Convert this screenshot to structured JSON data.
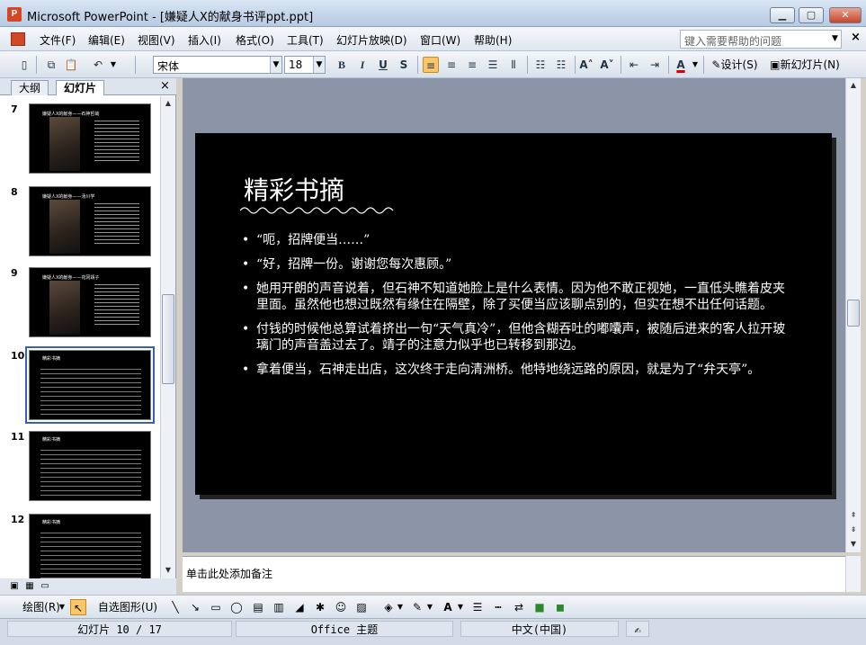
{
  "window": {
    "title": "Microsoft PowerPoint - [嫌疑人X的献身书评ppt.ppt]",
    "app_icon": "P",
    "controls": {
      "minimize": "▁",
      "maximize": "▢",
      "close": "✕"
    }
  },
  "menubar": {
    "items": [
      "文件(F)",
      "编辑(E)",
      "视图(V)",
      "插入(I)",
      "格式(O)",
      "工具(T)",
      "幻灯片放映(D)",
      "窗口(W)",
      "帮助(H)"
    ],
    "help_placeholder": "键入需要帮助的问题",
    "doc_close": "×"
  },
  "toolbar": {
    "font_name": "宋体",
    "font_size": "18",
    "bold": "B",
    "italic": "I",
    "underline": "U",
    "shadow": "S",
    "design_label": "设计(S)",
    "new_slide_label": "新幻灯片(N)"
  },
  "left_pane": {
    "tabs": [
      "大纲",
      "幻灯片"
    ],
    "close": "×",
    "thumbnails": [
      {
        "number": "7",
        "title": "嫌疑人X的献身——石神哲哉",
        "kind": "photo"
      },
      {
        "number": "8",
        "title": "嫌疑人X的献身——汤川学",
        "kind": "photo"
      },
      {
        "number": "9",
        "title": "嫌疑人X的献身——花冈靖子",
        "kind": "photo"
      },
      {
        "number": "10",
        "title": "精彩书摘",
        "kind": "text",
        "selected": true
      },
      {
        "number": "11",
        "title": "精彩书摘",
        "kind": "text"
      },
      {
        "number": "12",
        "title": "精彩书摘",
        "kind": "text"
      }
    ]
  },
  "slide": {
    "title": "精彩书摘",
    "bullets": [
      "“呃，招牌便当……”",
      "“好，招牌一份。谢谢您每次惠顾。”",
      "她用开朗的声音说着，但石神不知道她脸上是什么表情。因为他不敢正视她，一直低头瞧着皮夹里面。虽然他也想过既然有缘住在隔壁，除了买便当应该聊点别的，但实在想不出任何话题。",
      "付钱的时候他总算试着挤出一句“天气真冷”，但他含糊吞吐的嘟囔声，被随后进来的客人拉开玻璃门的声音盖过去了。靖子的注意力似乎也已转移到那边。",
      "拿着便当，石神走出店，这次终于走向清洲桥。他特地绕远路的原因，就是为了“弁天亭”。"
    ]
  },
  "notes": {
    "placeholder": "单击此处添加备注"
  },
  "drawbar": {
    "draw_label": "绘图(R)",
    "autoshape_label": "自选图形(U)"
  },
  "statusbar": {
    "slide_position": "幻灯片 10 / 17",
    "theme": "Office 主题",
    "language": "中文(中国)"
  },
  "colors": {
    "slide_bg": "#000000",
    "slide_text": "#ffffff",
    "workspace": "#8c94a8",
    "selection": "#3560c0"
  }
}
